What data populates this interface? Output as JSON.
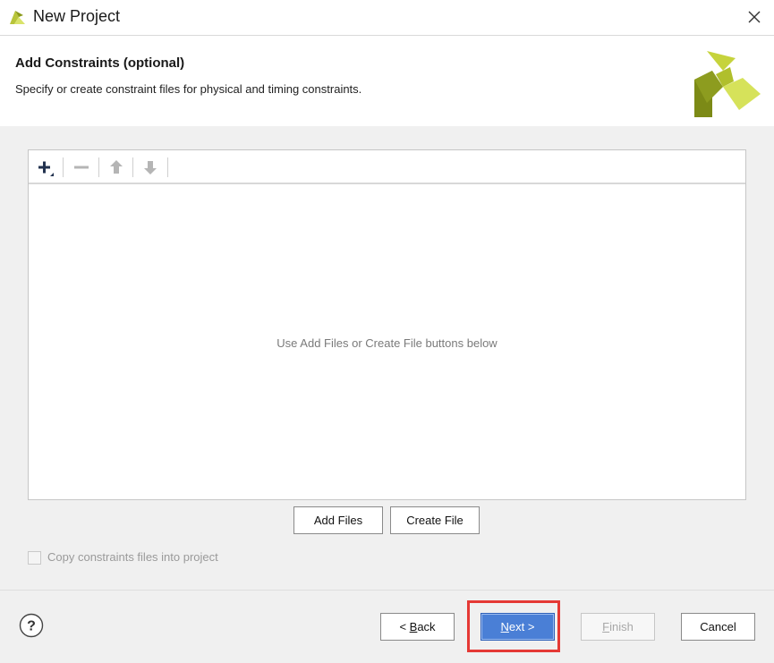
{
  "window": {
    "title": "New Project",
    "app_icon": "vivado-app-icon",
    "close_icon": "close-icon"
  },
  "header": {
    "title": "Add Constraints (optional)",
    "subtitle": "Specify or create constraint files for physical and timing constraints.",
    "logo": "xilinx-logo-icon"
  },
  "file_panel": {
    "toolbar": [
      {
        "icon": "add-icon",
        "enabled": true
      },
      {
        "icon": "remove-icon",
        "enabled": false
      },
      {
        "icon": "move-up-icon",
        "enabled": false
      },
      {
        "icon": "move-down-icon",
        "enabled": false
      }
    ],
    "empty_message": "Use Add Files or Create File buttons below",
    "add_files_label": "Add Files",
    "create_file_label": "Create File"
  },
  "options": {
    "copy_constraints_label": "Copy constraints files into project",
    "copy_constraints_checked": false,
    "copy_constraints_enabled": false
  },
  "footer": {
    "help_icon": "help-icon",
    "back": {
      "prefix": "< ",
      "mnemonic": "B",
      "rest": "ack"
    },
    "next": {
      "mnemonic": "N",
      "rest": "ext >"
    },
    "finish": {
      "mnemonic": "F",
      "rest": "inish"
    },
    "cancel_label": "Cancel"
  },
  "colors": {
    "primary_button": "#4a7fd6",
    "highlight": "#e53935",
    "logo_dark": "#7c8a16",
    "logo_light": "#d6e25a"
  }
}
